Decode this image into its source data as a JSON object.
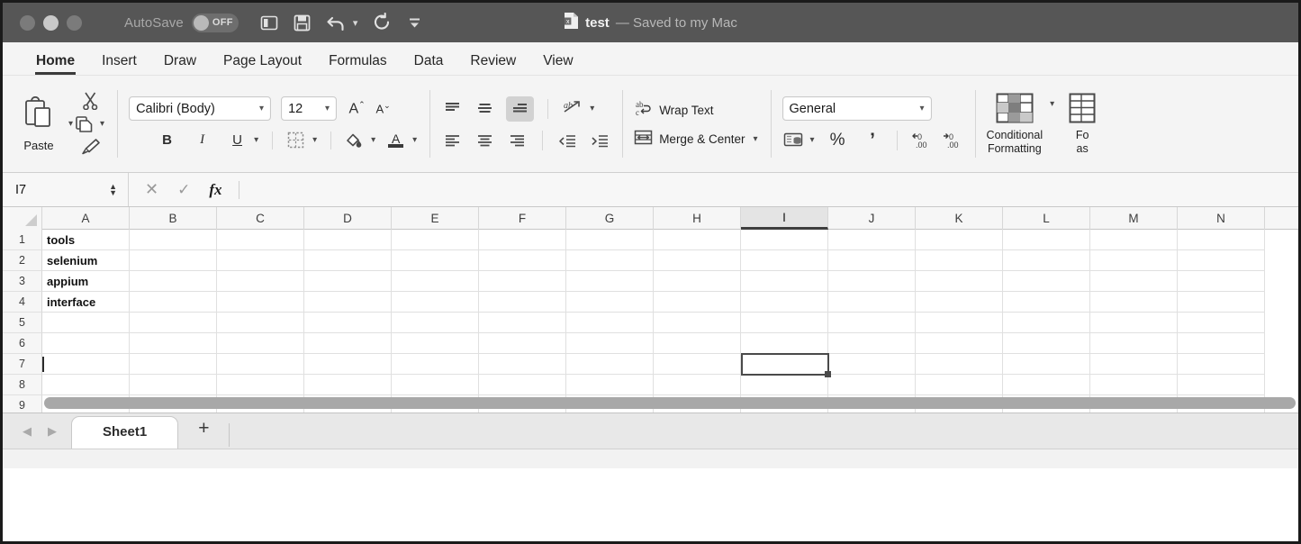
{
  "titlebar": {
    "autosave_label": "AutoSave",
    "autosave_state": "OFF",
    "doc_name": "test",
    "doc_state": "— Saved to my Mac",
    "quick_access": [
      "open-window-icon",
      "save-icon",
      "undo-icon",
      "redo-icon",
      "customize-toolbar-icon"
    ]
  },
  "tabs": [
    {
      "label": "Home",
      "active": true
    },
    {
      "label": "Insert",
      "active": false
    },
    {
      "label": "Draw",
      "active": false
    },
    {
      "label": "Page Layout",
      "active": false
    },
    {
      "label": "Formulas",
      "active": false
    },
    {
      "label": "Data",
      "active": false
    },
    {
      "label": "Review",
      "active": false
    },
    {
      "label": "View",
      "active": false
    }
  ],
  "ribbon": {
    "clipboard": {
      "paste_label": "Paste",
      "cut_label": "Cut",
      "copy_label": "Copy",
      "format_painter_label": "Format Painter"
    },
    "font": {
      "family_value": "Calibri (Body)",
      "size_value": "12",
      "bold_label": "B",
      "italic_label": "I",
      "underline_label": "U",
      "grow_font_label": "A",
      "shrink_font_label": "A",
      "borders_label": "Borders",
      "fill_color_label": "Fill Color",
      "font_color_label": "A"
    },
    "alignment": {
      "align_top_label": "Top Align",
      "align_middle_label": "Middle Align",
      "align_bottom_label": "Bottom Align",
      "align_bottom_selected": true,
      "orientation_label": "Orientation",
      "align_left_label": "Align Left",
      "align_center_label": "Center",
      "align_right_label": "Align Right",
      "decrease_indent_label": "Decrease Indent",
      "increase_indent_label": "Increase Indent",
      "wrap_text_label": "Wrap Text",
      "merge_center_label": "Merge & Center"
    },
    "number": {
      "format_value": "General",
      "accounting_label": "Accounting Number Format",
      "percent_label": "%",
      "comma_label": "’",
      "increase_decimal_label": "Increase Decimal",
      "decrease_decimal_label": "Decrease Decimal"
    },
    "styles": {
      "conditional_formatting_line1": "Conditional",
      "conditional_formatting_line2": "Formatting",
      "format_as_table_line1": "Fo",
      "format_as_table_line2": "as"
    }
  },
  "formula_bar": {
    "name_box_value": "I7",
    "cancel_label": "✕",
    "enter_label": "✓",
    "function_label": "fx",
    "input_value": ""
  },
  "grid": {
    "columns": [
      "A",
      "B",
      "C",
      "D",
      "E",
      "F",
      "G",
      "H",
      "I",
      "J",
      "K",
      "L",
      "M",
      "N"
    ],
    "active_column": "I",
    "rows": [
      "1",
      "2",
      "3",
      "4",
      "5",
      "6",
      "7",
      "8",
      "9"
    ],
    "active_row": "7",
    "cells": {
      "A1": "tools",
      "A2": "selenium",
      "A3": "appium",
      "A4": "interface"
    },
    "selected_cell": "I7"
  },
  "sheetbar": {
    "prev_label": "◀",
    "next_label": "▶",
    "sheets": [
      {
        "name": "Sheet1",
        "active": true
      }
    ],
    "add_sheet_label": "+"
  },
  "colors": {
    "titlebar_bg": "#565656",
    "ribbon_bg": "#f4f4f4",
    "selection_border": "#4a4a4a",
    "active_header_bg": "#e4e4e4",
    "scrollbar": "#a8a8a8"
  }
}
